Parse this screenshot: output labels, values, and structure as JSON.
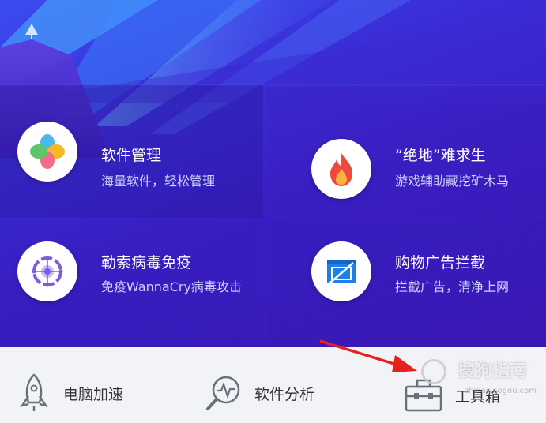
{
  "tiles": [
    {
      "title": "软件管理",
      "subtitle": "海量软件，轻松管理",
      "icon": "clover-icon"
    },
    {
      "title": "“绝地”难求生",
      "subtitle": "游戏辅助藏挖矿木马",
      "icon": "flame-icon"
    },
    {
      "title": "勒索病毒免疫",
      "subtitle": "免疫WannaCry病毒攻击",
      "icon": "crosshair-icon"
    },
    {
      "title": "购物广告拦截",
      "subtitle": "拦截广告，清净上网",
      "icon": "blocked-ad-icon"
    }
  ],
  "bottom_bar": {
    "items": [
      {
        "label": "电脑加速",
        "icon": "rocket-icon"
      },
      {
        "label": "软件分析",
        "icon": "magnifier-pulse-icon"
      },
      {
        "label": "工具箱",
        "icon": "toolbox-icon"
      }
    ]
  },
  "watermark": {
    "text": "搜狗指南",
    "sub": "zhinan.sogou.com"
  },
  "colors": {
    "accent": "#3a22c8",
    "arrow": "#e8201c"
  }
}
